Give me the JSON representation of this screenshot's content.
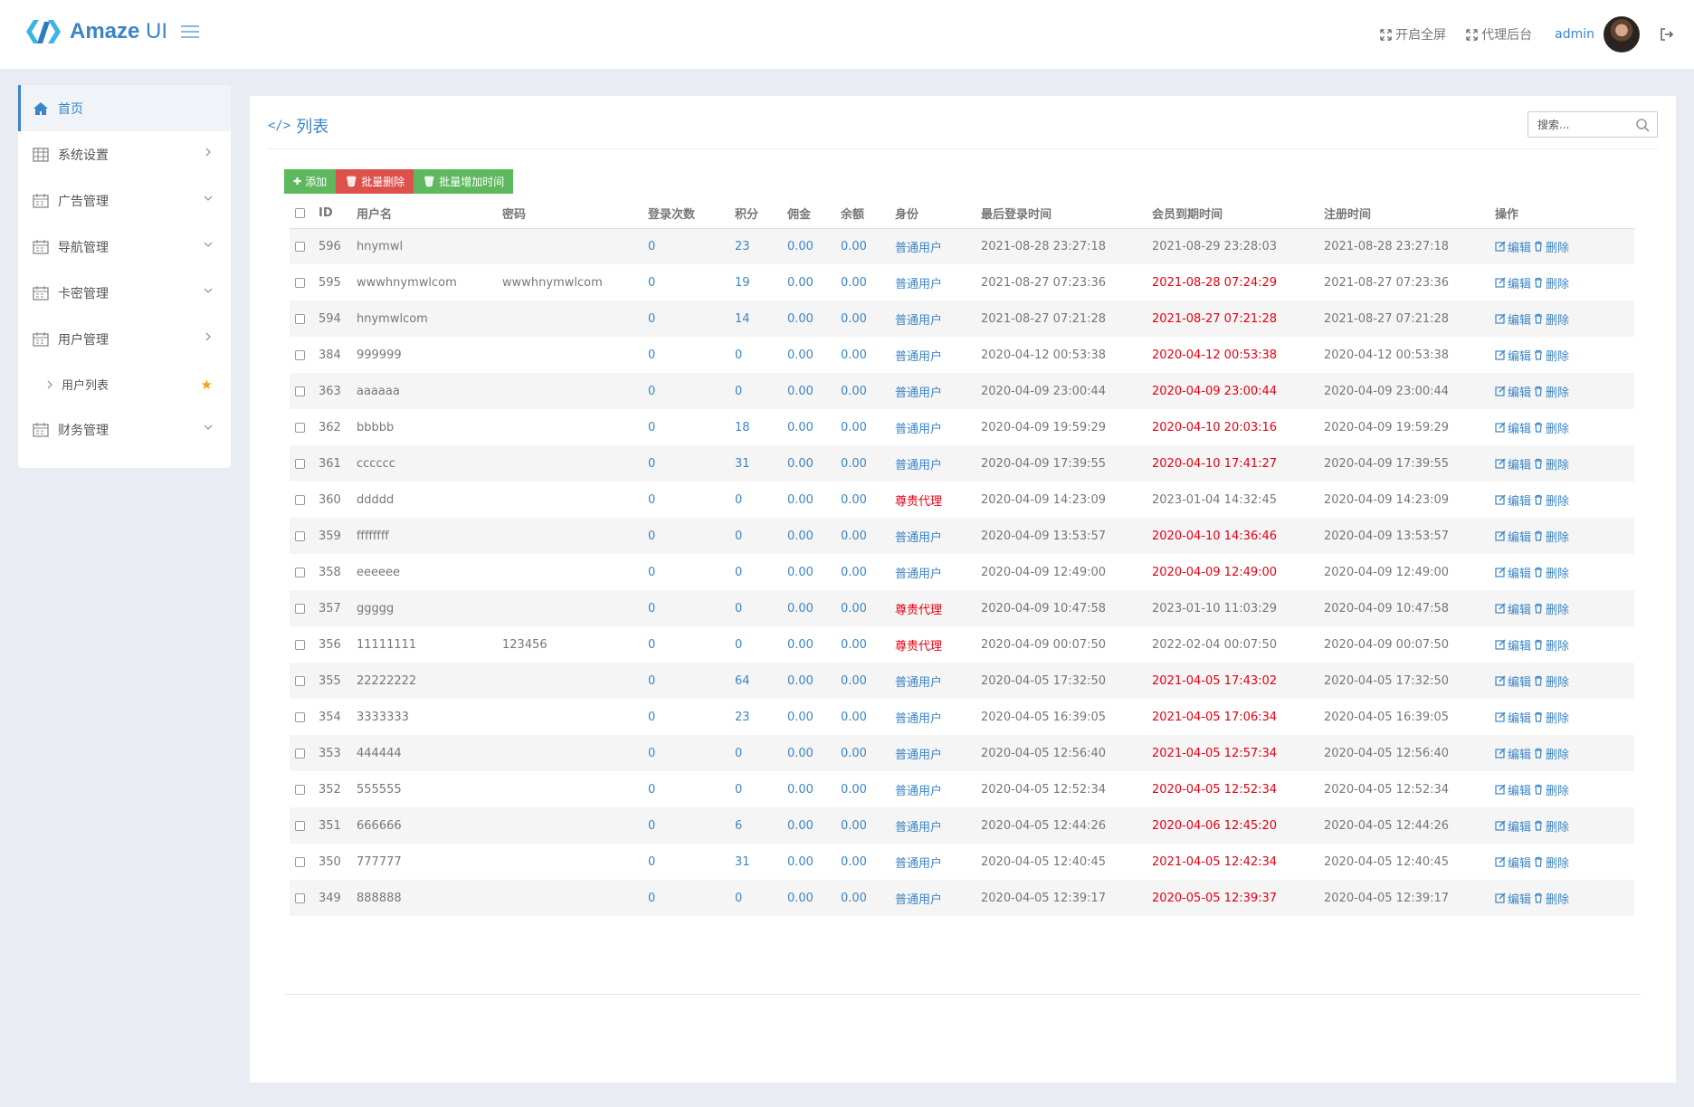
{
  "brand": {
    "name_bold": "Amaze",
    "name_light": " UI",
    "color": "#3b85c7"
  },
  "header": {
    "fullscreen": "开启全屏",
    "agent": "代理后台",
    "user": "admin"
  },
  "sidebar": {
    "items": [
      {
        "label": "首页",
        "icon": "home-icon",
        "active": true
      },
      {
        "label": "系统设置",
        "icon": "table-icon",
        "arrow": "right"
      },
      {
        "label": "广告管理",
        "icon": "calendar-icon",
        "arrow": "down"
      },
      {
        "label": "导航管理",
        "icon": "calendar-icon",
        "arrow": "down"
      },
      {
        "label": "卡密管理",
        "icon": "calendar-icon",
        "arrow": "down"
      },
      {
        "label": "用户管理",
        "icon": "calendar-icon",
        "arrow": "right"
      },
      {
        "label": "用户列表",
        "sub": true,
        "star": "★"
      },
      {
        "label": "财务管理",
        "icon": "calendar-icon",
        "arrow": "down"
      }
    ]
  },
  "panel": {
    "title_icon": "</>",
    "title": "列表",
    "search_placeholder": "搜索..."
  },
  "toolbar": {
    "add": "添加",
    "batch_delete": "批量删除",
    "batch_add_time": "批量增加时间",
    "green": "#5eb95e",
    "red": "#dd514c"
  },
  "table": {
    "columns": [
      "ID",
      "用户名",
      "密码",
      "登录次数",
      "积分",
      "佣金",
      "余额",
      "身份",
      "最后登录时间",
      "会员到期时间",
      "注册时间",
      "操作"
    ],
    "edit_label": "编辑",
    "delete_label": "删除",
    "rows": [
      {
        "id": "596",
        "user": "hnymwl",
        "pwd": "",
        "logins": "0",
        "points": "23",
        "comm": "0.00",
        "bal": "0.00",
        "role": "普通用户",
        "role_red": false,
        "last": "2021-08-28 23:27:18",
        "expire": "2021-08-29 23:28:03",
        "expire_red": false,
        "reg": "2021-08-28 23:27:18"
      },
      {
        "id": "595",
        "user": "wwwhnymwlcom",
        "pwd": "wwwhnymwlcom",
        "logins": "0",
        "points": "19",
        "comm": "0.00",
        "bal": "0.00",
        "role": "普通用户",
        "role_red": false,
        "last": "2021-08-27 07:23:36",
        "expire": "2021-08-28 07:24:29",
        "expire_red": true,
        "reg": "2021-08-27 07:23:36"
      },
      {
        "id": "594",
        "user": "hnymwlcom",
        "pwd": "",
        "logins": "0",
        "points": "14",
        "comm": "0.00",
        "bal": "0.00",
        "role": "普通用户",
        "role_red": false,
        "last": "2021-08-27 07:21:28",
        "expire": "2021-08-27 07:21:28",
        "expire_red": true,
        "reg": "2021-08-27 07:21:28"
      },
      {
        "id": "384",
        "user": "999999",
        "pwd": "",
        "logins": "0",
        "points": "0",
        "comm": "0.00",
        "bal": "0.00",
        "role": "普通用户",
        "role_red": false,
        "last": "2020-04-12 00:53:38",
        "expire": "2020-04-12 00:53:38",
        "expire_red": true,
        "reg": "2020-04-12 00:53:38"
      },
      {
        "id": "363",
        "user": "aaaaaa",
        "pwd": "",
        "logins": "0",
        "points": "0",
        "comm": "0.00",
        "bal": "0.00",
        "role": "普通用户",
        "role_red": false,
        "last": "2020-04-09 23:00:44",
        "expire": "2020-04-09 23:00:44",
        "expire_red": true,
        "reg": "2020-04-09 23:00:44"
      },
      {
        "id": "362",
        "user": "bbbbb",
        "pwd": "",
        "logins": "0",
        "points": "18",
        "comm": "0.00",
        "bal": "0.00",
        "role": "普通用户",
        "role_red": false,
        "last": "2020-04-09 19:59:29",
        "expire": "2020-04-10 20:03:16",
        "expire_red": true,
        "reg": "2020-04-09 19:59:29"
      },
      {
        "id": "361",
        "user": "cccccc",
        "pwd": "",
        "logins": "0",
        "points": "31",
        "comm": "0.00",
        "bal": "0.00",
        "role": "普通用户",
        "role_red": false,
        "last": "2020-04-09 17:39:55",
        "expire": "2020-04-10 17:41:27",
        "expire_red": true,
        "reg": "2020-04-09 17:39:55"
      },
      {
        "id": "360",
        "user": "ddddd",
        "pwd": "",
        "logins": "0",
        "points": "0",
        "comm": "0.00",
        "bal": "0.00",
        "role": "尊贵代理",
        "role_red": true,
        "last": "2020-04-09 14:23:09",
        "expire": "2023-01-04 14:32:45",
        "expire_red": false,
        "reg": "2020-04-09 14:23:09"
      },
      {
        "id": "359",
        "user": "ffffffff",
        "pwd": "",
        "logins": "0",
        "points": "0",
        "comm": "0.00",
        "bal": "0.00",
        "role": "普通用户",
        "role_red": false,
        "last": "2020-04-09 13:53:57",
        "expire": "2020-04-10 14:36:46",
        "expire_red": true,
        "reg": "2020-04-09 13:53:57"
      },
      {
        "id": "358",
        "user": "eeeeee",
        "pwd": "",
        "logins": "0",
        "points": "0",
        "comm": "0.00",
        "bal": "0.00",
        "role": "普通用户",
        "role_red": false,
        "last": "2020-04-09 12:49:00",
        "expire": "2020-04-09 12:49:00",
        "expire_red": true,
        "reg": "2020-04-09 12:49:00"
      },
      {
        "id": "357",
        "user": "ggggg",
        "pwd": "",
        "logins": "0",
        "points": "0",
        "comm": "0.00",
        "bal": "0.00",
        "role": "尊贵代理",
        "role_red": true,
        "last": "2020-04-09 10:47:58",
        "expire": "2023-01-10 11:03:29",
        "expire_red": false,
        "reg": "2020-04-09 10:47:58"
      },
      {
        "id": "356",
        "user": "11111111",
        "pwd": "123456",
        "logins": "0",
        "points": "0",
        "comm": "0.00",
        "bal": "0.00",
        "role": "尊贵代理",
        "role_red": true,
        "last": "2020-04-09 00:07:50",
        "expire": "2022-02-04 00:07:50",
        "expire_red": false,
        "reg": "2020-04-09 00:07:50"
      },
      {
        "id": "355",
        "user": "22222222",
        "pwd": "",
        "logins": "0",
        "points": "64",
        "comm": "0.00",
        "bal": "0.00",
        "role": "普通用户",
        "role_red": false,
        "last": "2020-04-05 17:32:50",
        "expire": "2021-04-05 17:43:02",
        "expire_red": true,
        "reg": "2020-04-05 17:32:50"
      },
      {
        "id": "354",
        "user": "3333333",
        "pwd": "",
        "logins": "0",
        "points": "23",
        "comm": "0.00",
        "bal": "0.00",
        "role": "普通用户",
        "role_red": false,
        "last": "2020-04-05 16:39:05",
        "expire": "2021-04-05 17:06:34",
        "expire_red": true,
        "reg": "2020-04-05 16:39:05"
      },
      {
        "id": "353",
        "user": "444444",
        "pwd": "",
        "logins": "0",
        "points": "0",
        "comm": "0.00",
        "bal": "0.00",
        "role": "普通用户",
        "role_red": false,
        "last": "2020-04-05 12:56:40",
        "expire": "2021-04-05 12:57:34",
        "expire_red": true,
        "reg": "2020-04-05 12:56:40"
      },
      {
        "id": "352",
        "user": "555555",
        "pwd": "",
        "logins": "0",
        "points": "0",
        "comm": "0.00",
        "bal": "0.00",
        "role": "普通用户",
        "role_red": false,
        "last": "2020-04-05 12:52:34",
        "expire": "2020-04-05 12:52:34",
        "expire_red": true,
        "reg": "2020-04-05 12:52:34"
      },
      {
        "id": "351",
        "user": "666666",
        "pwd": "",
        "logins": "0",
        "points": "6",
        "comm": "0.00",
        "bal": "0.00",
        "role": "普通用户",
        "role_red": false,
        "last": "2020-04-05 12:44:26",
        "expire": "2020-04-06 12:45:20",
        "expire_red": true,
        "reg": "2020-04-05 12:44:26"
      },
      {
        "id": "350",
        "user": "777777",
        "pwd": "",
        "logins": "0",
        "points": "31",
        "comm": "0.00",
        "bal": "0.00",
        "role": "普通用户",
        "role_red": false,
        "last": "2020-04-05 12:40:45",
        "expire": "2021-04-05 12:42:34",
        "expire_red": true,
        "reg": "2020-04-05 12:40:45"
      },
      {
        "id": "349",
        "user": "888888",
        "pwd": "",
        "logins": "0",
        "points": "0",
        "comm": "0.00",
        "bal": "0.00",
        "role": "普通用户",
        "role_red": false,
        "last": "2020-04-05 12:39:17",
        "expire": "2020-05-05 12:39:37",
        "expire_red": true,
        "reg": "2020-04-05 12:39:17"
      }
    ]
  }
}
